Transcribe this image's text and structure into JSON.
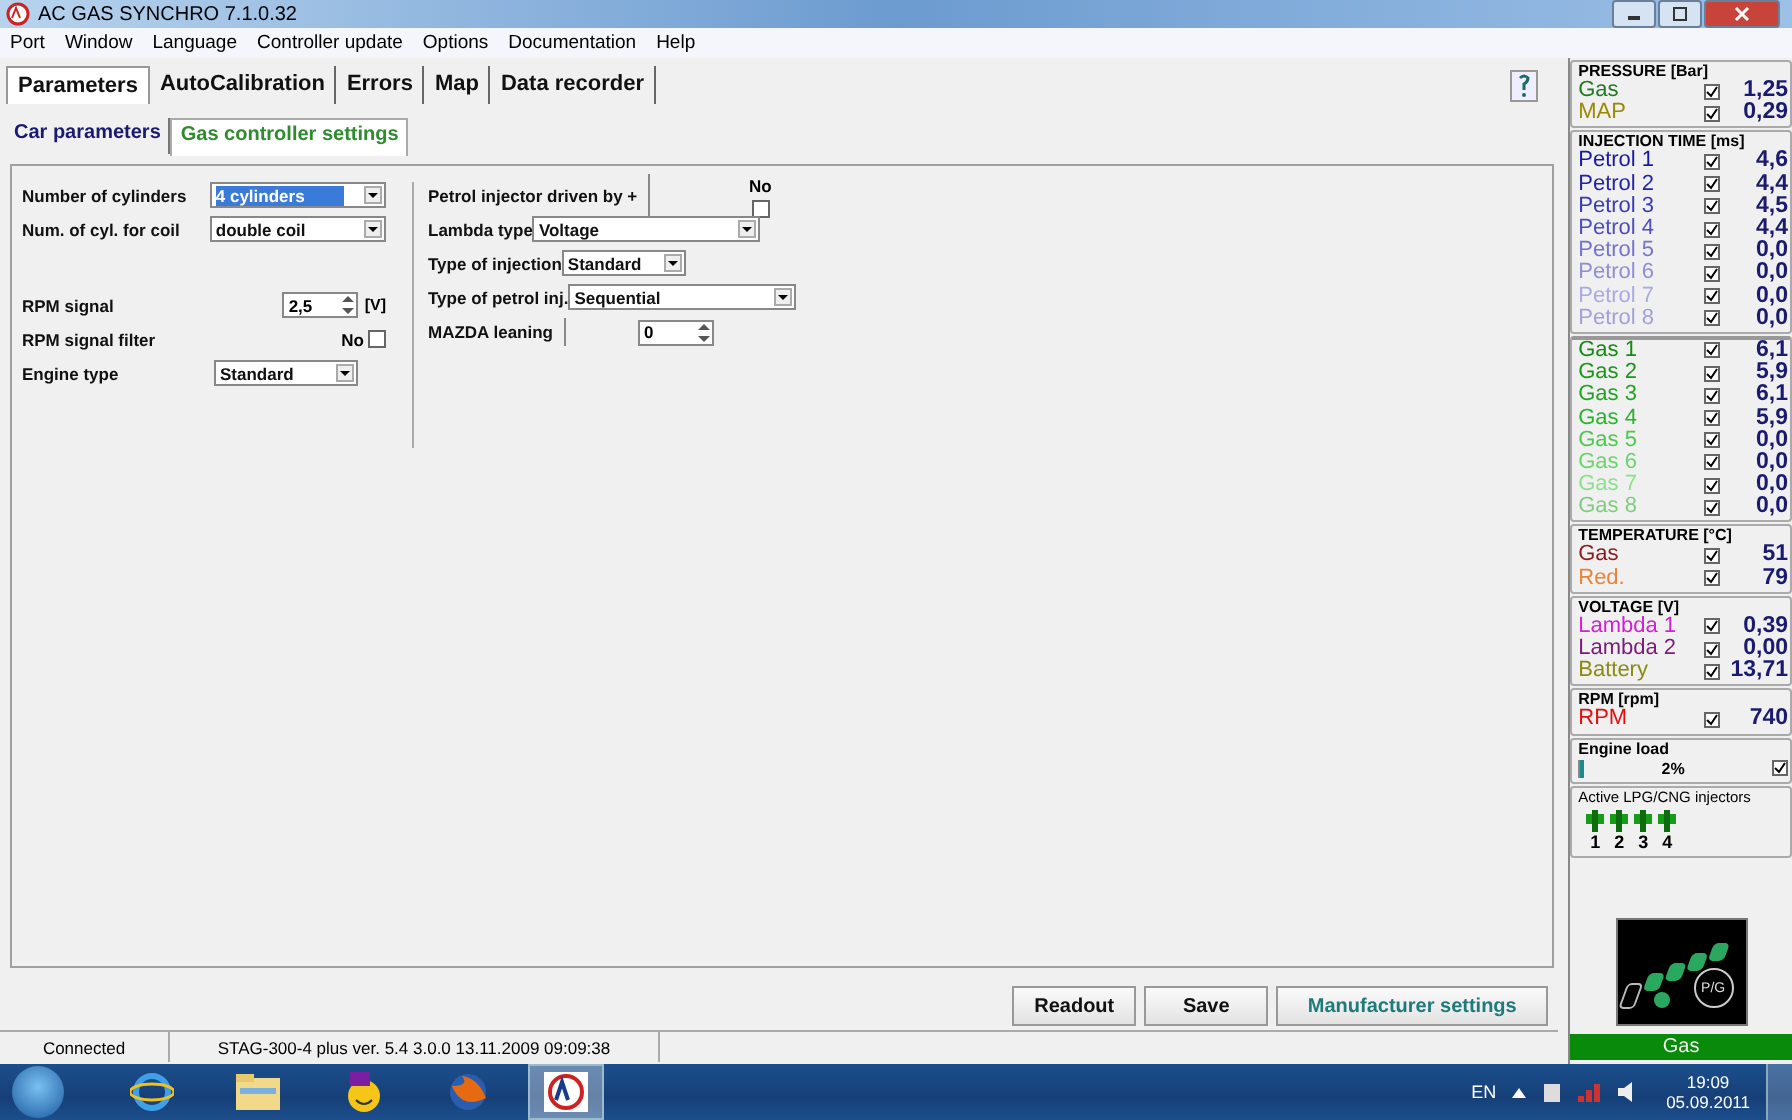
{
  "window": {
    "title": "AC GAS SYNCHRO  7.1.0.32"
  },
  "menu": [
    "Port",
    "Window",
    "Language",
    "Controller update",
    "Options",
    "Documentation",
    "Help"
  ],
  "tabs": [
    {
      "label": "Parameters",
      "selected": true
    },
    {
      "label": "AutoCalibration",
      "selected": false
    },
    {
      "label": "Errors",
      "selected": false
    },
    {
      "label": "Map",
      "selected": false
    },
    {
      "label": "Data recorder",
      "selected": false
    }
  ],
  "sub_tabs": [
    {
      "label": "Car parameters",
      "selected": false,
      "color": "#1a1a6e"
    },
    {
      "label": "Gas controller settings",
      "selected": true,
      "color": "#2e8b2e"
    }
  ],
  "left_groups": [
    [
      {
        "kind": "select",
        "label": "Number of cylinders",
        "value": "4 cylinders",
        "highlighted": true
      },
      {
        "kind": "select",
        "label": "Num. of cyl. for coil",
        "value": "double coil",
        "highlighted": false
      }
    ],
    [
      {
        "kind": "spin",
        "label": "RPM signal",
        "value": "2,5",
        "unit": "[V]"
      },
      {
        "kind": "checkbox",
        "label": "RPM signal filter",
        "value": "No",
        "checked": false
      },
      {
        "kind": "select",
        "label": "Engine type",
        "value": "Standard",
        "highlighted": false
      }
    ]
  ],
  "right_fields": [
    {
      "kind": "checkbox",
      "label": "Petrol injector driven by +",
      "value": "No",
      "checked": false
    },
    {
      "kind": "select",
      "label": "Lambda type",
      "value": "Voltage",
      "highlighted": false
    },
    {
      "kind": "select",
      "label": "Type of injection",
      "value": "Standard",
      "highlighted": false
    },
    {
      "kind": "select",
      "label": "Type of petrol inj.",
      "value": "Sequential",
      "highlighted": false
    },
    {
      "kind": "spin",
      "label": "MAZDA leaning",
      "value": "0"
    }
  ],
  "buttons": [
    "Readout",
    "Save",
    "Manufacturer settings"
  ],
  "status_bar": [
    "Connected",
    "STAG-300-4 plus   ver. 5.4  3.0.0    13.11.2009 09:09:38"
  ],
  "monitor": [
    {
      "title": "PRESSURE [Bar]",
      "rows": [
        {
          "label": "Gas",
          "color": "#1f7a1f",
          "checked": true,
          "value": "1,25"
        },
        {
          "label": "MAP",
          "color": "#9a8a00",
          "checked": true,
          "value": "0,29"
        }
      ]
    },
    {
      "title": "INJECTION TIME [ms]",
      "rows": [
        {
          "label": "Petrol 1",
          "color": "#1a1aa0",
          "checked": true,
          "value": "4,6"
        },
        {
          "label": "Petrol 2",
          "color": "#2323a8",
          "checked": true,
          "value": "4,4"
        },
        {
          "label": "Petrol 3",
          "color": "#3a3ab4",
          "checked": true,
          "value": "4,5"
        },
        {
          "label": "Petrol 4",
          "color": "#4d4dbd",
          "checked": true,
          "value": "4,4"
        },
        {
          "label": "Petrol 5",
          "color": "#7474cf",
          "checked": true,
          "value": "0,0"
        },
        {
          "label": "Petrol 6",
          "color": "#8e8ed8",
          "checked": true,
          "value": "0,0"
        },
        {
          "label": "Petrol 7",
          "color": "#a9a9e4",
          "checked": true,
          "value": "0,0"
        },
        {
          "label": "Petrol 8",
          "color": "#a0a0dc",
          "checked": true,
          "value": "0,0"
        }
      ]
    },
    {
      "rows": [
        {
          "label": "Gas 1",
          "color": "#138a13",
          "checked": true,
          "value": "6,1"
        },
        {
          "label": "Gas 2",
          "color": "#1a961a",
          "checked": true,
          "value": "5,9"
        },
        {
          "label": "Gas 3",
          "color": "#20a420",
          "checked": true,
          "value": "6,1"
        },
        {
          "label": "Gas 4",
          "color": "#28b428",
          "checked": true,
          "value": "5,9"
        },
        {
          "label": "Gas 5",
          "color": "#4cc84c",
          "checked": true,
          "value": "0,0"
        },
        {
          "label": "Gas 6",
          "color": "#6ad46a",
          "checked": true,
          "value": "0,0"
        },
        {
          "label": "Gas 7",
          "color": "#8cdf8c",
          "checked": true,
          "value": "0,0"
        },
        {
          "label": "Gas 8",
          "color": "#80cc80",
          "checked": true,
          "value": "0,0"
        }
      ]
    },
    {
      "title": "TEMPERATURE [°C]",
      "rows": [
        {
          "label": "Gas",
          "color": "#8b1a1a",
          "checked": true,
          "value": "51"
        },
        {
          "label": "Red.",
          "color": "#e8843a",
          "checked": true,
          "value": "79"
        }
      ]
    },
    {
      "title": "VOLTAGE [V]",
      "rows": [
        {
          "label": "Lambda 1",
          "color": "#d020d0",
          "checked": true,
          "value": "0,39"
        },
        {
          "label": "Lambda 2",
          "color": "#7a1a7a",
          "checked": true,
          "value": "0,00"
        },
        {
          "label": "Battery",
          "color": "#8a8a10",
          "checked": true,
          "value": "13,71"
        }
      ]
    },
    {
      "title": "RPM [rpm]",
      "rows": [
        {
          "label": "RPM",
          "color": "#e01010",
          "checked": true,
          "value": "740"
        }
      ]
    }
  ],
  "engine_load": {
    "title": "Engine load",
    "reading": "2%",
    "level": 0.02,
    "checked": true
  },
  "injectors": {
    "title": "Active LPG/CNG injectors",
    "items": [
      {
        "label": "1",
        "on": true
      },
      {
        "label": "2",
        "on": true
      },
      {
        "label": "3",
        "on": true
      },
      {
        "label": "4",
        "on": true
      }
    ]
  },
  "gauge": {
    "button": "P/G",
    "leds": [
      {
        "on": false
      },
      {
        "on": true
      },
      {
        "on": true
      },
      {
        "on": true
      },
      {
        "on": true
      }
    ],
    "dot_on": true
  },
  "fuel_status": "Gas",
  "taskbar": {
    "language": "EN",
    "time": "19:09",
    "date": "05.09.2011"
  }
}
